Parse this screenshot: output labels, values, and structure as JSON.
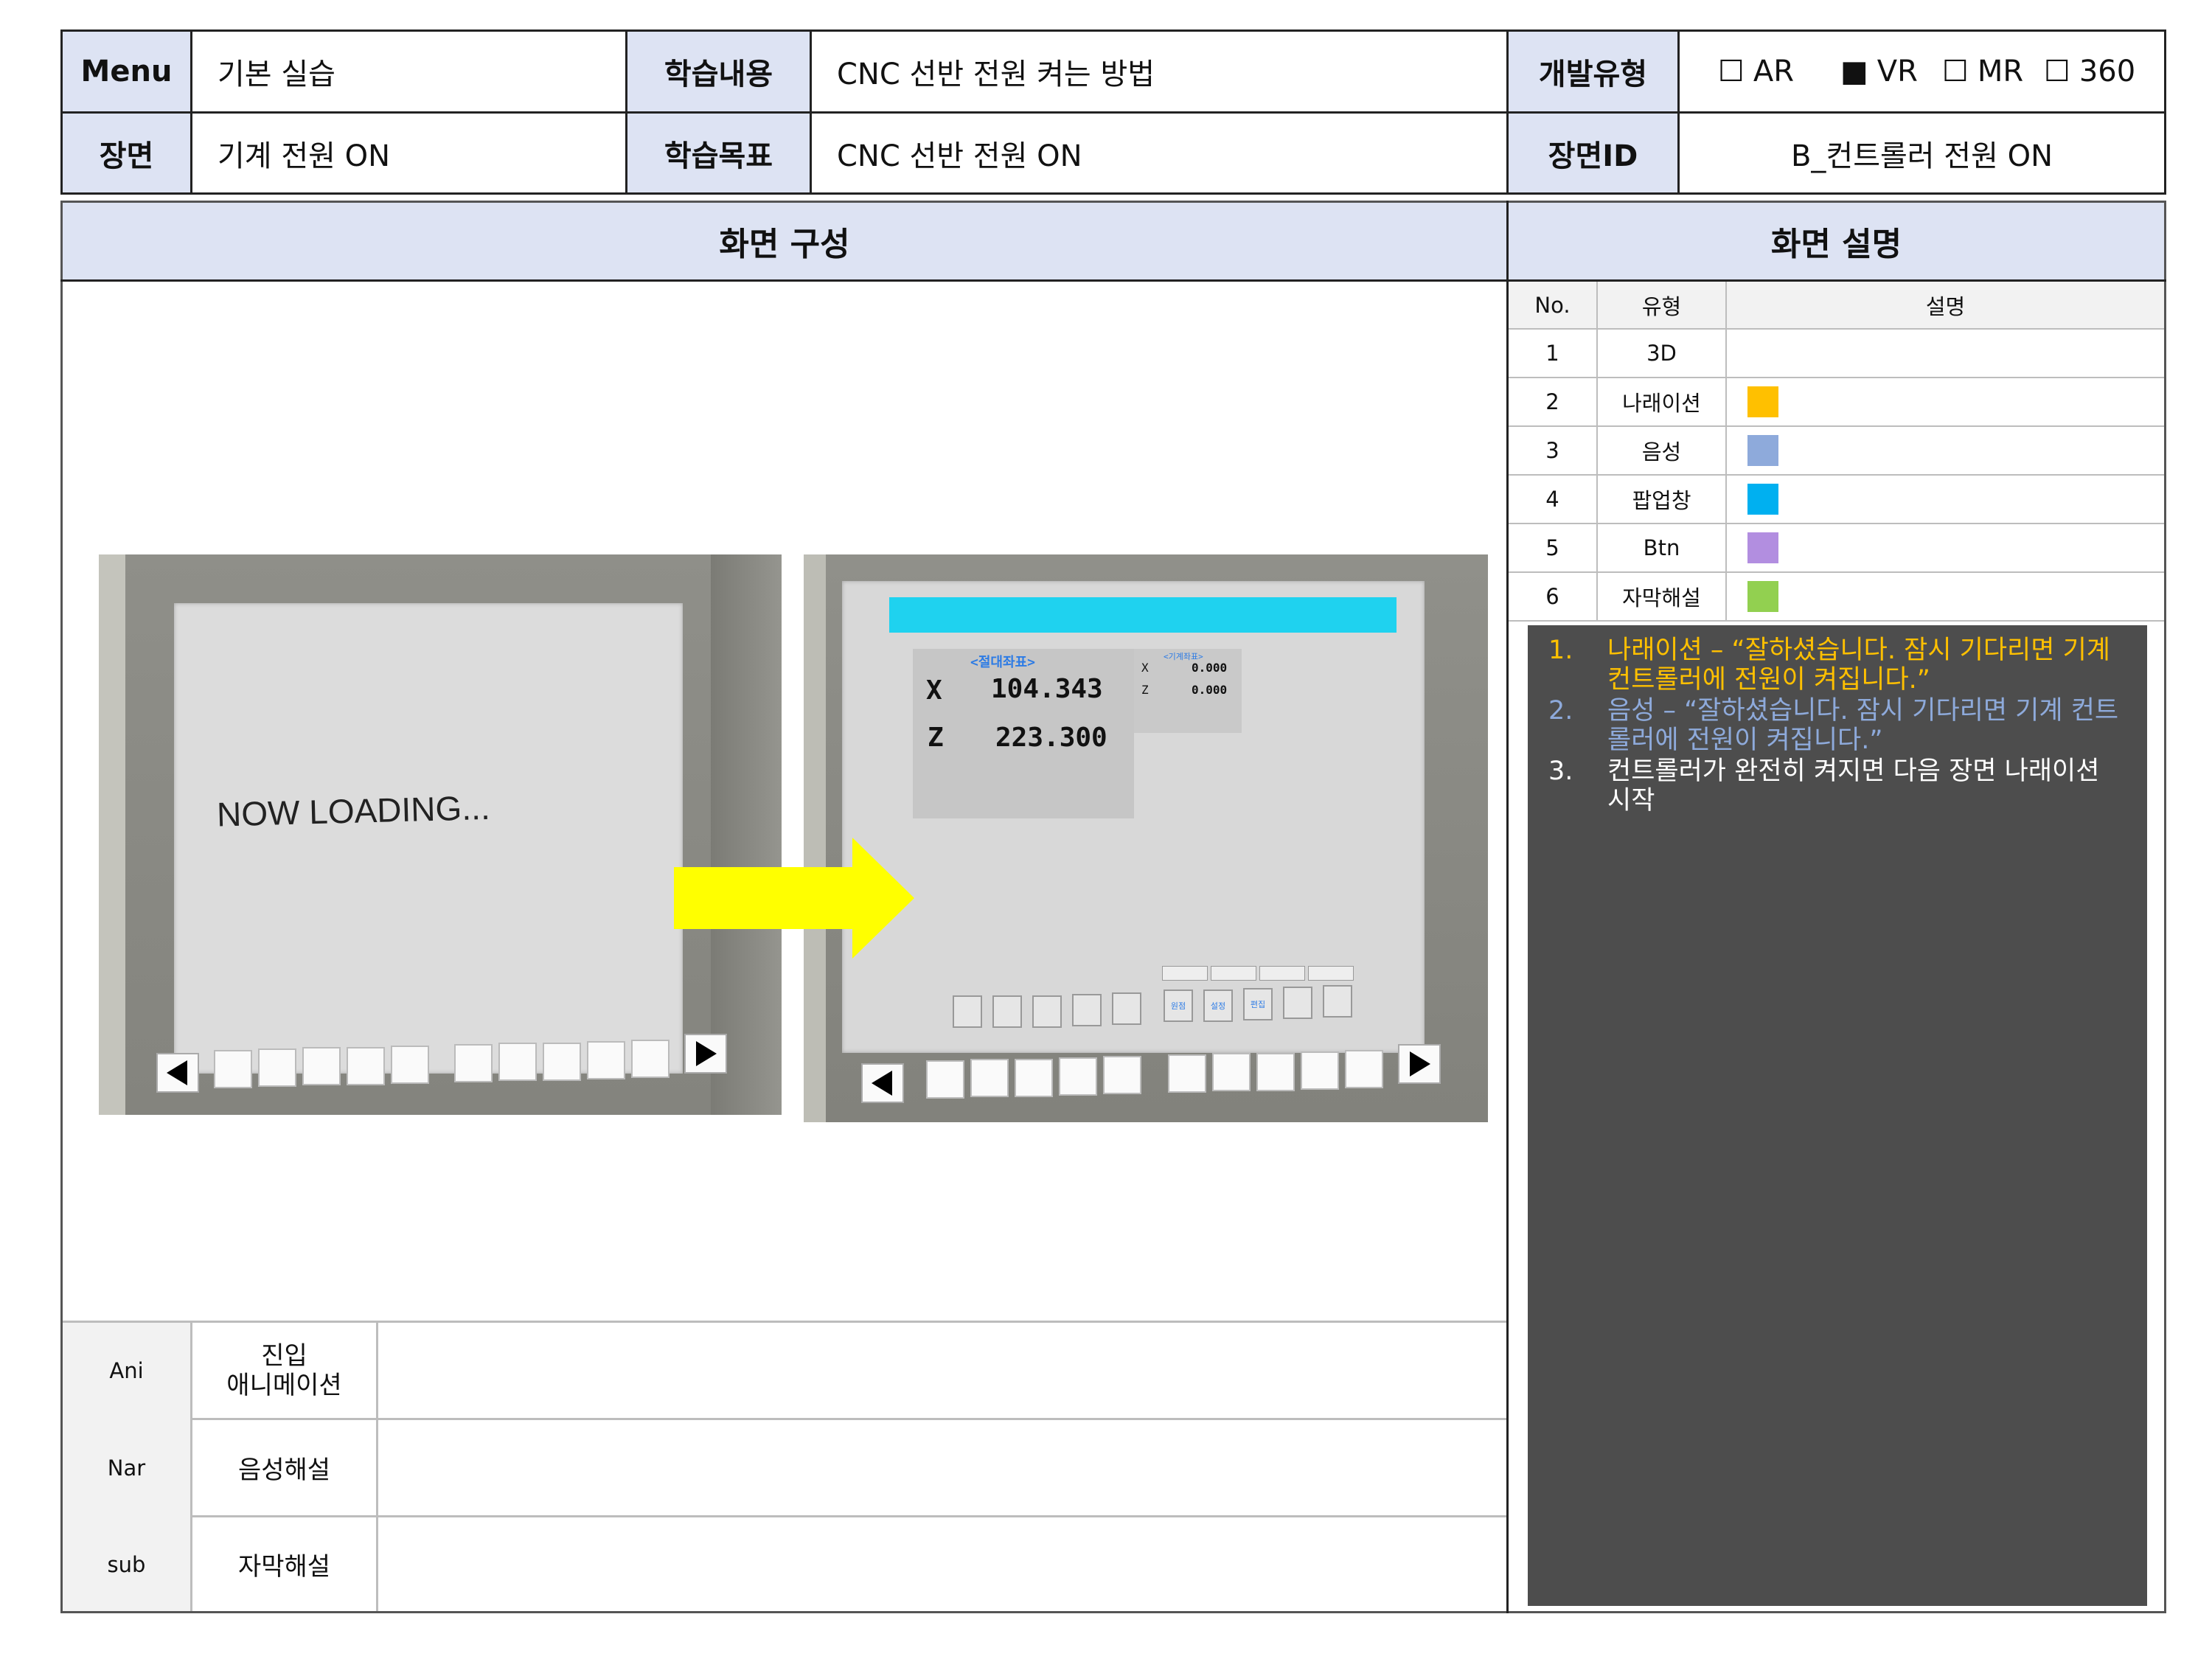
{
  "header": {
    "menu_label": "Menu",
    "menu_value": "기본 실습",
    "content_label": "학습내용",
    "content_value": "CNC 선반 전원 켜는 방법",
    "devtype_label": "개발유형",
    "devtypes": [
      {
        "label": "AR",
        "mark": "☐"
      },
      {
        "label": "VR",
        "mark": "■"
      },
      {
        "label": "MR",
        "mark": "☐"
      },
      {
        "label": "360",
        "mark": "☐"
      }
    ],
    "scene_label": "장면",
    "scene_value": "기계 전원 ON",
    "goal_label": "학습목표",
    "goal_value": "CNC 선반 전원 ON",
    "sceneid_label": "장면ID",
    "sceneid_value": "B_컨트롤러 전원 ON"
  },
  "composition": {
    "title": "화면 구성",
    "left_screen_text": "NOW LOADING...",
    "right_screen": {
      "title": "<절대좌표>",
      "x_label": "X",
      "x_value": "104.343",
      "z_label": "Z",
      "z_value": "223.300",
      "aux_title": "<기계좌표>",
      "aux_x_label": "X",
      "aux_x_value": "0.000",
      "aux_z_label": "Z",
      "aux_z_value": "0.000",
      "buttons": [
        "원점",
        "설정",
        "편집"
      ]
    }
  },
  "bottom_rows": [
    {
      "code": "Ani",
      "label": "진입\n애니메이션"
    },
    {
      "code": "Nar",
      "label": "음성해설"
    },
    {
      "code": "sub",
      "label": "자막해설"
    }
  ],
  "description": {
    "title": "화면 설명",
    "headers": [
      "No.",
      "유형",
      "설명"
    ],
    "legend": [
      {
        "no": "1",
        "type": "3D",
        "color": ""
      },
      {
        "no": "2",
        "type": "나래이션",
        "color": "#ffc000"
      },
      {
        "no": "3",
        "type": "음성",
        "color": "#8eaadb"
      },
      {
        "no": "4",
        "type": "팝업창",
        "color": "#00b0f0"
      },
      {
        "no": "5",
        "type": "Btn",
        "color": "#b28ee0"
      },
      {
        "no": "6",
        "type": "자막해설",
        "color": "#92d050"
      }
    ],
    "items": [
      {
        "num": "1.",
        "text": "나래이션 – “잘하셨습니다. 잠시 기다리면 기계 컨트롤러에 전원이 켜집니다.”",
        "color": "#ffc000"
      },
      {
        "num": "2.",
        "text": "음성 – “잘하셨습니다. 잠시 기다리면 기계 컨트롤러에 전원이 켜집니다.”",
        "color": "#8eaadb"
      },
      {
        "num": "3.",
        "text": "컨트롤러가 완전히 켜지면 다음 장면 나래이션 시작",
        "color": "#ffffff"
      }
    ]
  }
}
